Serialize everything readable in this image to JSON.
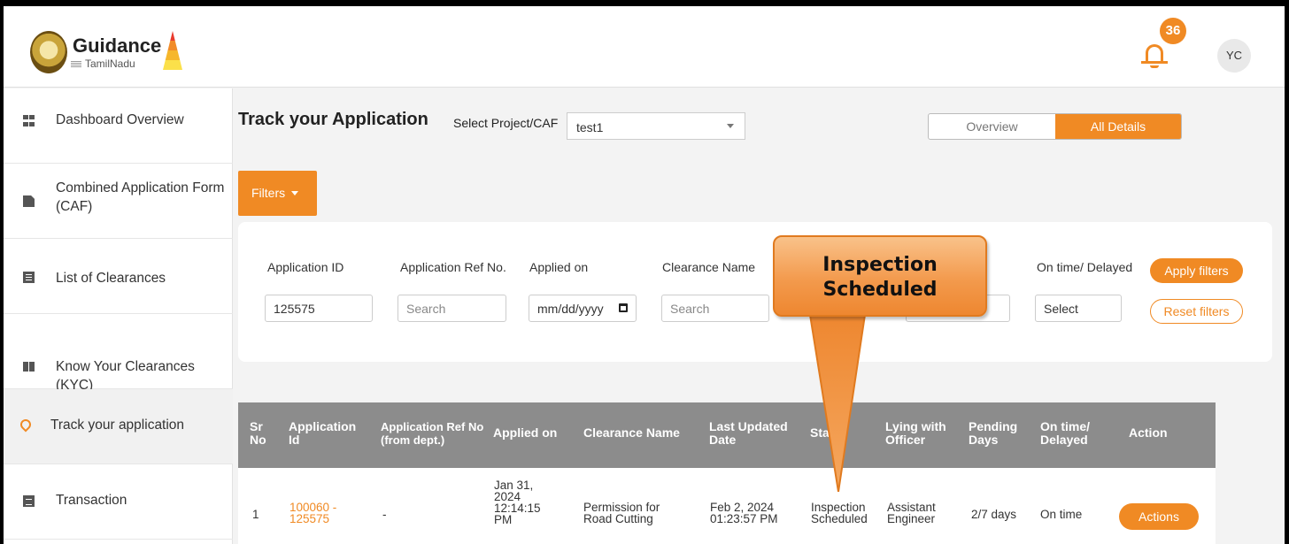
{
  "header": {
    "logo_title": "Guidance",
    "logo_subtitle": "TamilNadu",
    "notification_count": "36",
    "avatar_initials": "YC"
  },
  "sidebar": {
    "items": [
      {
        "label": "Dashboard Overview",
        "icon": "dashboard-icon"
      },
      {
        "label": "Combined Application Form (CAF)",
        "icon": "document-icon"
      },
      {
        "label": "List of Clearances",
        "icon": "list-icon"
      },
      {
        "label": "Know Your Clearances (KYC)",
        "icon": "book-icon"
      },
      {
        "label": "Track your application",
        "icon": "location-pin-icon",
        "active": true
      },
      {
        "label": "Transaction",
        "icon": "transaction-icon"
      }
    ]
  },
  "main": {
    "title": "Track your Application",
    "project_label": "Select Project/CAF",
    "project_value": "test1",
    "view_toggle": [
      "Overview",
      "All Details"
    ],
    "filters_label": "Filters",
    "filters": {
      "application_id_label": "Application ID",
      "application_id_value": "125575",
      "ref_no_label": "Application Ref No.",
      "ref_no_placeholder": "Search",
      "applied_on_label": "Applied on",
      "applied_on_placeholder": "mm/dd/yyyy",
      "clearance_name_label": "Clearance Name",
      "clearance_name_placeholder": "Search",
      "ontime_label": "On time/ Delayed",
      "ontime_value": "Select",
      "apply_label": "Apply filters",
      "reset_label": "Reset filters"
    },
    "table": {
      "headers": [
        "Sr No",
        "Application Id",
        "Application Ref No (from dept.)",
        "Applied on",
        "Clearance Name",
        "Last Updated Date",
        "Status",
        "Lying with Officer",
        "Pending Days",
        "On time/ Delayed",
        "Action"
      ],
      "rows": [
        {
          "sr": "1",
          "app_id": "100060 - 125575",
          "ref_no": "-",
          "applied_on": "Jan 31, 2024 12:14:15 PM",
          "clearance": "Permission for Road Cutting",
          "last_updated": "Feb 2, 2024 01:23:57 PM",
          "status": "Inspection Scheduled",
          "officer": "Assistant Engineer",
          "pending_days": "2/7 days",
          "ontime": "On time",
          "action": "Actions"
        }
      ]
    }
  },
  "callout": {
    "line1": "Inspection",
    "line2": "Scheduled"
  },
  "colors": {
    "accent": "#f08a24",
    "table_header": "#8c8c8c"
  }
}
